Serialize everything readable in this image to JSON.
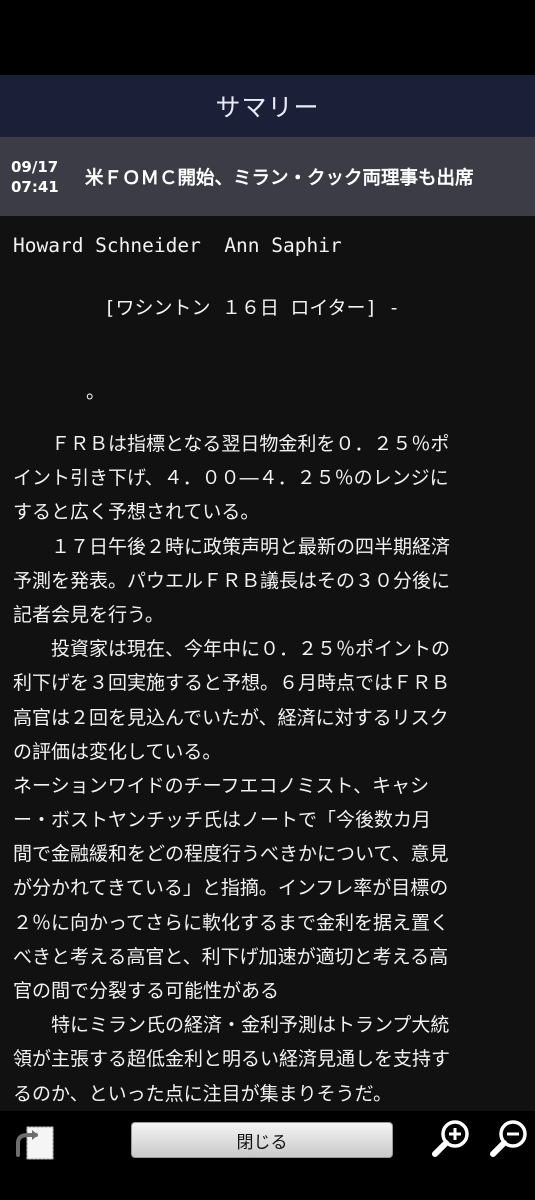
{
  "header": {
    "title": "サマリー"
  },
  "headline": {
    "date": "09/17",
    "time": "07:41",
    "text": "米ＦＯＭＣ開始、ミラン・クック両理事も出席"
  },
  "article": {
    "byline": "Howard Schneider  Ann Saphir",
    "dateline": "[ワシントン １６日 ロイター] -",
    "mark": "。",
    "lines": [
      "　　ＦＲＢは指標となる翌日物金利を０．２５％ポ",
      "イント引き下げ、４．００―４．２５％のレンジに",
      "すると広く予想されている。",
      "　　１７日午後２時に政策声明と最新の四半期経済",
      "予測を発表。パウエルＦＲＢ議長はその３０分後に",
      "記者会見を行う。",
      "　　投資家は現在、今年中に０．２５％ポイントの",
      "利下げを３回実施すると予想。６月時点ではＦＲＢ",
      "高官は２回を見込んでいたが、経済に対するリスク",
      "の評価は変化している。",
      "ネーションワイドのチーフエコノミスト、キャシ",
      "ー・ボストヤンチッチ氏はノートで「今後数カ月",
      "間で金融緩和をどの程度行うべきかについて、意見",
      "が分かれてきている」と指摘。インフレ率が目標の",
      "２％に向かってさらに軟化するまで金利を据え置く",
      "べきと考える高官と、利下げ加速が適切と考える高",
      "官の間で分裂する可能性がある",
      "　　特にミラン氏の経済・金利予測はトランプ大統",
      "領が主張する超低金利と明るい経済見通しを支持す",
      "るのか、といった点に注目が集まりそうだ。"
    ]
  },
  "footer": {
    "close_label": "閉じる",
    "icons": [
      "share-icon",
      "zoom-in-icon",
      "zoom-out-icon"
    ]
  }
}
